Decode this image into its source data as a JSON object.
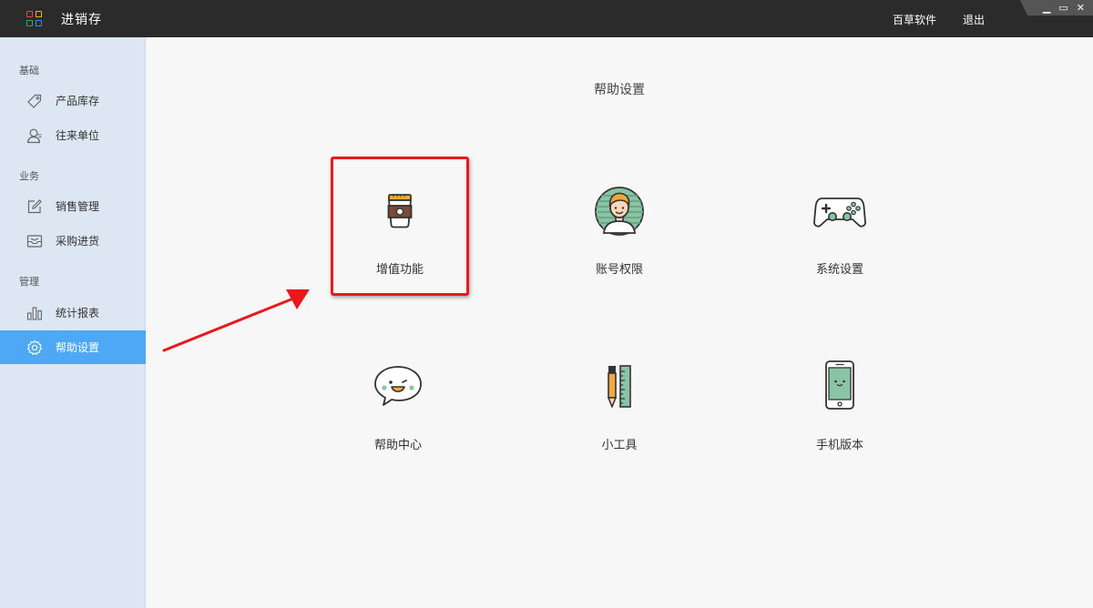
{
  "app": {
    "title": "进销存",
    "logo_colors": [
      "#e8453c",
      "#f4b400",
      "#34a853",
      "#4285f4"
    ]
  },
  "header": {
    "links": [
      {
        "label": "百草软件"
      },
      {
        "label": "退出"
      }
    ],
    "window_controls": {
      "minimize": "▁",
      "maximize": "▭",
      "close": "✕"
    }
  },
  "sidebar": {
    "groups": [
      {
        "label": "基础",
        "items": [
          {
            "label": "产品库存",
            "icon": "tag-icon"
          },
          {
            "label": "往来单位",
            "icon": "contact-icon"
          }
        ]
      },
      {
        "label": "业务",
        "items": [
          {
            "label": "销售管理",
            "icon": "edit-icon"
          },
          {
            "label": "采购进货",
            "icon": "inbox-icon"
          }
        ]
      },
      {
        "label": "管理",
        "items": [
          {
            "label": "统计报表",
            "icon": "bar-chart-icon"
          },
          {
            "label": "帮助设置",
            "icon": "gear-icon",
            "active": true
          }
        ]
      }
    ],
    "active_color": "#4ea8f5"
  },
  "main": {
    "title": "帮助设置",
    "tiles": [
      {
        "label": "增值功能",
        "icon": "coffee-cup-icon"
      },
      {
        "label": "账号权限",
        "icon": "user-avatar-icon"
      },
      {
        "label": "系统设置",
        "icon": "gamepad-icon"
      },
      {
        "label": "帮助中心",
        "icon": "chat-bubble-icon"
      },
      {
        "label": "小工具",
        "icon": "pencil-ruler-icon"
      },
      {
        "label": "手机版本",
        "icon": "smartphone-icon"
      }
    ],
    "highlight_color": "#e8191b"
  }
}
